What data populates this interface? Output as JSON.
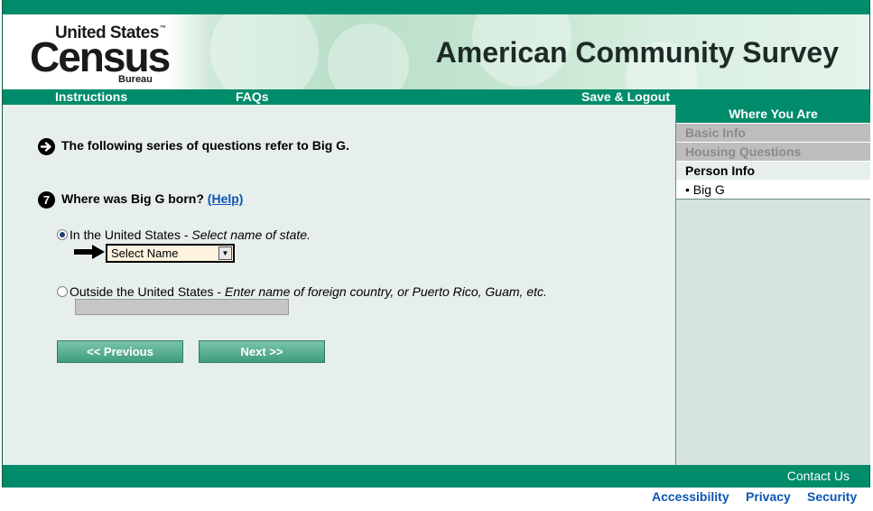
{
  "logo": {
    "line1": "United States",
    "tm": "™",
    "line2": "Census",
    "line3": "Bureau"
  },
  "banner": {
    "title": "American Community Survey"
  },
  "nav": {
    "instructions": "Instructions",
    "faqs": "FAQs",
    "save_logout": "Save & Logout"
  },
  "intro": {
    "text": "The following series of questions refer to Big G."
  },
  "question": {
    "number": "7",
    "text": "Where was Big G born?",
    "help": "(Help)",
    "option_us": {
      "label": "In the United States - ",
      "hint": "Select name of state.",
      "selected": true
    },
    "state_select": {
      "value": "Select Name"
    },
    "option_outside": {
      "label": "Outside the United States - ",
      "hint": "Enter name of foreign country, or Puerto Rico, Guam, etc.",
      "selected": false
    },
    "country_input": {
      "value": ""
    }
  },
  "buttons": {
    "previous": "<<  Previous",
    "next": "Next  >>"
  },
  "sidebar": {
    "title": "Where You Are",
    "items": [
      {
        "label": "Basic Info",
        "state": "disabled"
      },
      {
        "label": "Housing Questions",
        "state": "disabled"
      },
      {
        "label": "Person Info",
        "state": "section"
      },
      {
        "label": "• Big G",
        "state": "current"
      }
    ]
  },
  "footer": {
    "contact": "Contact Us"
  },
  "links": {
    "accessibility": "Accessibility",
    "privacy": "Privacy",
    "security": "Security"
  },
  "colors": {
    "brand_green": "#008c6a",
    "link_blue": "#0b56b3",
    "panel": "#e7efec",
    "sidebar_bg": "#d5e4de"
  },
  "icons": {
    "intro": "arrow-right-circle-icon",
    "question": "number-circle-icon",
    "pointer": "black-arrow-right-icon",
    "dropdown": "triangle-down-icon"
  }
}
